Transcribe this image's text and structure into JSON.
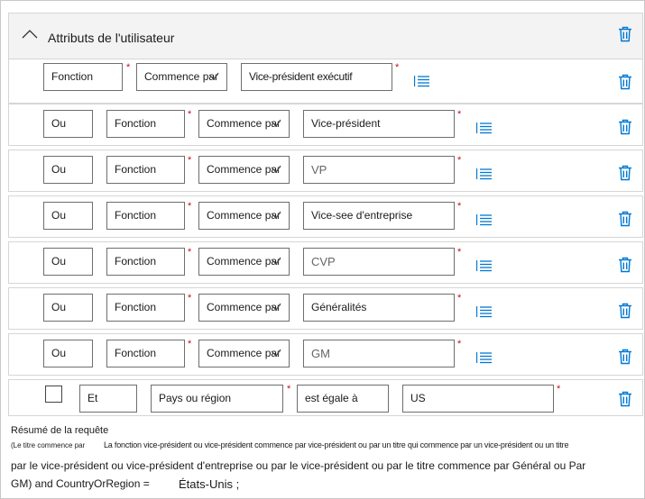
{
  "section": {
    "title": "Attributs de l'utilisateur"
  },
  "rows": [
    {
      "field": "Fonction",
      "operator": "Commence par",
      "value": "Vice-président exécutif"
    },
    {
      "connector": "Ou",
      "field": "Fonction",
      "operator": "Commence par",
      "value": "Vice-président"
    },
    {
      "connector": "Ou",
      "field": "Fonction",
      "operator": "Commence par",
      "value": "VP"
    },
    {
      "connector": "Ou",
      "field": "Fonction",
      "operator": "Commence par",
      "value": "Vice-see d'entreprise"
    },
    {
      "connector": "Ou",
      "field": "Fonction",
      "operator": "Commence par",
      "value": "CVP"
    },
    {
      "connector": "Ou",
      "field": "Fonction",
      "operator": "Commence par",
      "value": "Généralités"
    },
    {
      "connector": "Ou",
      "field": "Fonction",
      "operator": "Commence par",
      "value": "GM"
    },
    {
      "connector": "Et",
      "field": "Pays ou région",
      "operator": "est égale à",
      "value": "US"
    }
  ],
  "summary": {
    "title": "Résumé de la requête",
    "line1a": "(Le titre commence par",
    "line1b": "La fonction vice-président ou vice-président commence par vice-président ou par un titre qui commence par un vice-président ou un titre",
    "line2": "par le vice-président ou vice-président d'entreprise ou par le vice-président ou par le titre commence par Général ou Par",
    "line3a": "GM) and CountryOrRegion =",
    "line3b": "États-Unis ;"
  },
  "colors": {
    "accent": "#0078d4",
    "required": "#c50f1f",
    "header_bg": "#f3f3f3",
    "border": "#d6d6d6"
  },
  "icons": {
    "collapse": "chevron-up-icon",
    "delete": "trash-icon",
    "values": "list-icon",
    "dropdown": "chevron-down-icon"
  }
}
